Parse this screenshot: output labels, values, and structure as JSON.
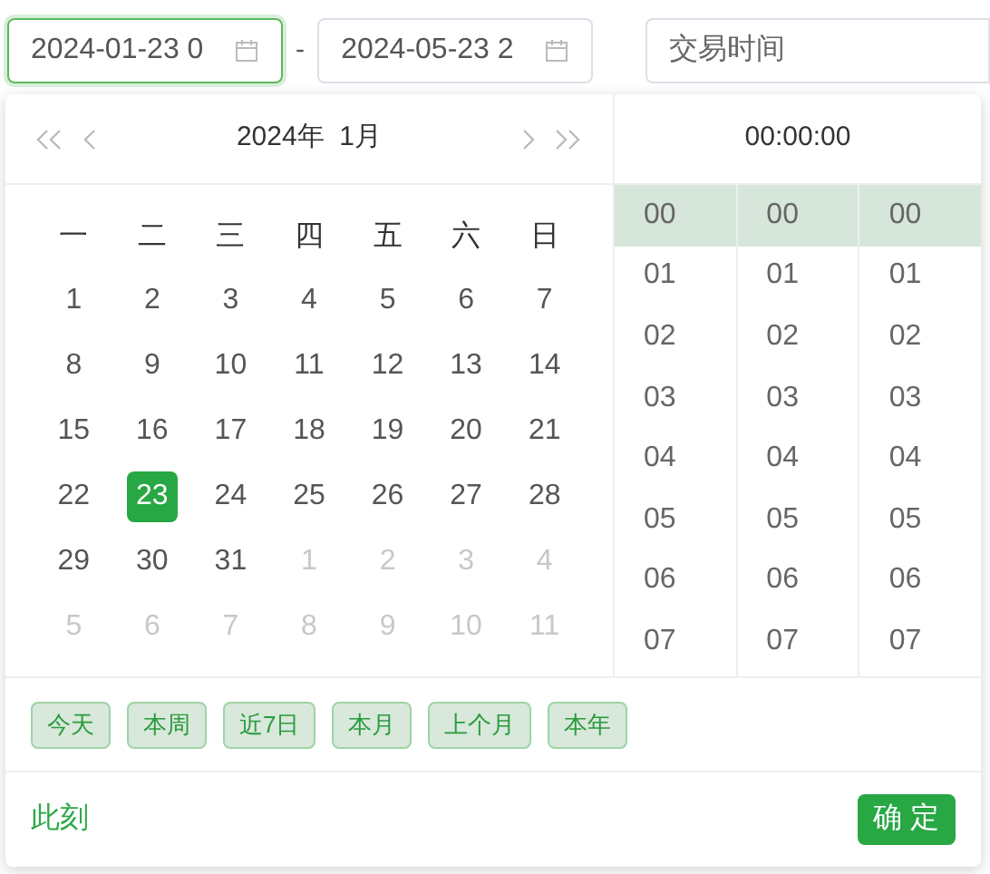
{
  "start_input": {
    "value": "2024-01-23 0",
    "focused": true
  },
  "separator": "-",
  "end_input": {
    "value": "2024-05-23 2",
    "focused": false
  },
  "filter_field": {
    "placeholder": "交易时间"
  },
  "calendar": {
    "header": "2024年  1月",
    "weekdays": [
      "一",
      "二",
      "三",
      "四",
      "五",
      "六",
      "日"
    ],
    "weeks": [
      [
        {
          "day": "1",
          "muted": false,
          "selected": false
        },
        {
          "day": "2",
          "muted": false,
          "selected": false
        },
        {
          "day": "3",
          "muted": false,
          "selected": false
        },
        {
          "day": "4",
          "muted": false,
          "selected": false
        },
        {
          "day": "5",
          "muted": false,
          "selected": false
        },
        {
          "day": "6",
          "muted": false,
          "selected": false
        },
        {
          "day": "7",
          "muted": false,
          "selected": false
        }
      ],
      [
        {
          "day": "8",
          "muted": false,
          "selected": false
        },
        {
          "day": "9",
          "muted": false,
          "selected": false
        },
        {
          "day": "10",
          "muted": false,
          "selected": false
        },
        {
          "day": "11",
          "muted": false,
          "selected": false
        },
        {
          "day": "12",
          "muted": false,
          "selected": false
        },
        {
          "day": "13",
          "muted": false,
          "selected": false
        },
        {
          "day": "14",
          "muted": false,
          "selected": false
        }
      ],
      [
        {
          "day": "15",
          "muted": false,
          "selected": false
        },
        {
          "day": "16",
          "muted": false,
          "selected": false
        },
        {
          "day": "17",
          "muted": false,
          "selected": false
        },
        {
          "day": "18",
          "muted": false,
          "selected": false
        },
        {
          "day": "19",
          "muted": false,
          "selected": false
        },
        {
          "day": "20",
          "muted": false,
          "selected": false
        },
        {
          "day": "21",
          "muted": false,
          "selected": false
        }
      ],
      [
        {
          "day": "22",
          "muted": false,
          "selected": false
        },
        {
          "day": "23",
          "muted": false,
          "selected": true
        },
        {
          "day": "24",
          "muted": false,
          "selected": false
        },
        {
          "day": "25",
          "muted": false,
          "selected": false
        },
        {
          "day": "26",
          "muted": false,
          "selected": false
        },
        {
          "day": "27",
          "muted": false,
          "selected": false
        },
        {
          "day": "28",
          "muted": false,
          "selected": false
        }
      ],
      [
        {
          "day": "29",
          "muted": false,
          "selected": false
        },
        {
          "day": "30",
          "muted": false,
          "selected": false
        },
        {
          "day": "31",
          "muted": false,
          "selected": false
        },
        {
          "day": "1",
          "muted": true,
          "selected": false
        },
        {
          "day": "2",
          "muted": true,
          "selected": false
        },
        {
          "day": "3",
          "muted": true,
          "selected": false
        },
        {
          "day": "4",
          "muted": true,
          "selected": false
        }
      ],
      [
        {
          "day": "5",
          "muted": true,
          "selected": false
        },
        {
          "day": "6",
          "muted": true,
          "selected": false
        },
        {
          "day": "7",
          "muted": true,
          "selected": false
        },
        {
          "day": "8",
          "muted": true,
          "selected": false
        },
        {
          "day": "9",
          "muted": true,
          "selected": false
        },
        {
          "day": "10",
          "muted": true,
          "selected": false
        },
        {
          "day": "11",
          "muted": true,
          "selected": false
        }
      ]
    ]
  },
  "time": {
    "header": "00:00:00",
    "columns": [
      [
        {
          "label": "00",
          "selected": true
        },
        {
          "label": "01",
          "selected": false
        },
        {
          "label": "02",
          "selected": false
        },
        {
          "label": "03",
          "selected": false
        },
        {
          "label": "04",
          "selected": false
        },
        {
          "label": "05",
          "selected": false
        },
        {
          "label": "06",
          "selected": false
        },
        {
          "label": "07",
          "selected": false
        }
      ],
      [
        {
          "label": "00",
          "selected": true
        },
        {
          "label": "01",
          "selected": false
        },
        {
          "label": "02",
          "selected": false
        },
        {
          "label": "03",
          "selected": false
        },
        {
          "label": "04",
          "selected": false
        },
        {
          "label": "05",
          "selected": false
        },
        {
          "label": "06",
          "selected": false
        },
        {
          "label": "07",
          "selected": false
        }
      ],
      [
        {
          "label": "00",
          "selected": true
        },
        {
          "label": "01",
          "selected": false
        },
        {
          "label": "02",
          "selected": false
        },
        {
          "label": "03",
          "selected": false
        },
        {
          "label": "04",
          "selected": false
        },
        {
          "label": "05",
          "selected": false
        },
        {
          "label": "06",
          "selected": false
        },
        {
          "label": "07",
          "selected": false
        }
      ]
    ]
  },
  "shortcuts": [
    "今天",
    "本周",
    "近7日",
    "本月",
    "上个月",
    "本年"
  ],
  "now_link": "此刻",
  "confirm_button": "确 定"
}
